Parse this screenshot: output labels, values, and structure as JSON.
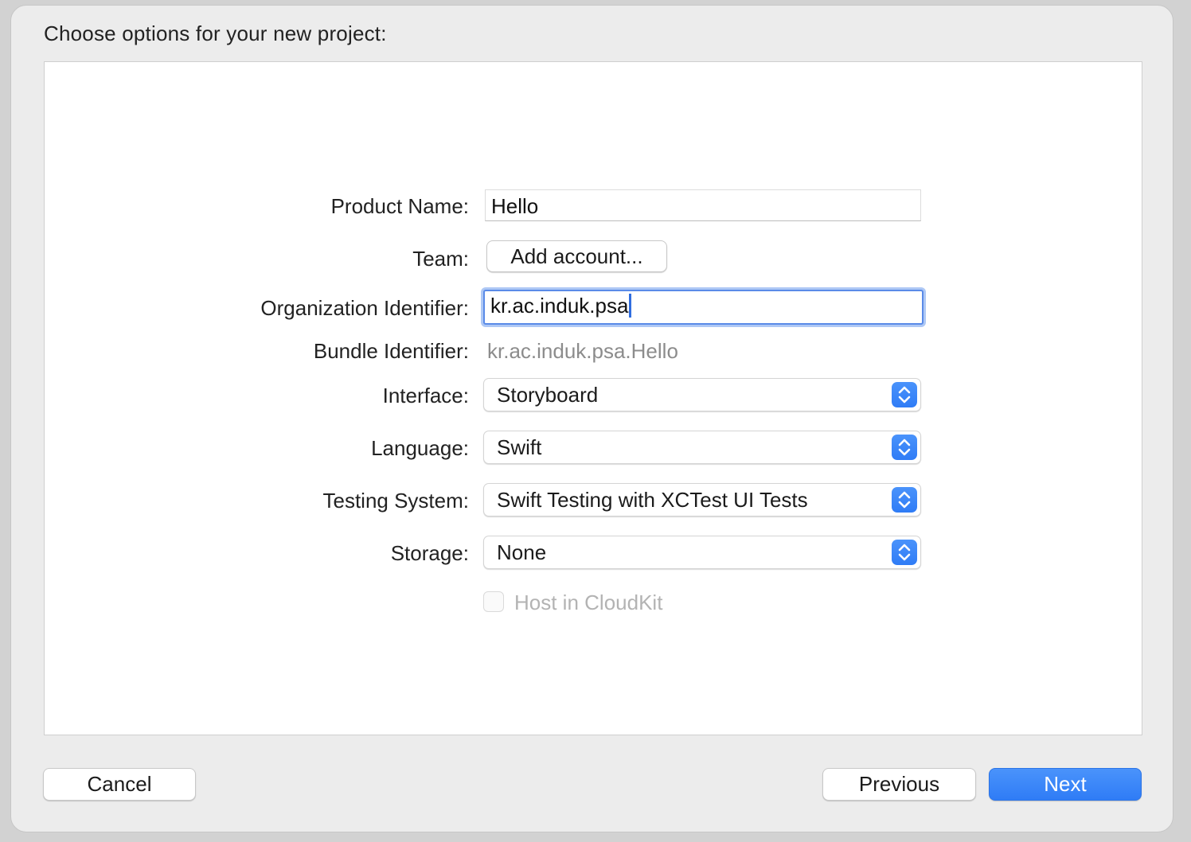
{
  "sheet": {
    "title": "Choose options for your new project:"
  },
  "form": {
    "product_name": {
      "label": "Product Name:",
      "value": "Hello"
    },
    "team": {
      "label": "Team:",
      "button_label": "Add account..."
    },
    "organization_identifier": {
      "label": "Organization Identifier:",
      "value": "kr.ac.induk.psa"
    },
    "bundle_identifier": {
      "label": "Bundle Identifier:",
      "value": "kr.ac.induk.psa.Hello"
    },
    "interface": {
      "label": "Interface:",
      "selected": "Storyboard"
    },
    "language": {
      "label": "Language:",
      "selected": "Swift"
    },
    "testing_system": {
      "label": "Testing System:",
      "selected": "Swift Testing with XCTest UI Tests"
    },
    "storage": {
      "label": "Storage:",
      "selected": "None"
    },
    "host_in_cloudkit": {
      "label": "Host in CloudKit",
      "checked": false,
      "enabled": false
    }
  },
  "footer": {
    "cancel_label": "Cancel",
    "previous_label": "Previous",
    "next_label": "Next"
  },
  "colors": {
    "accent": "#2f7cf6",
    "focus_ring": "#aec8f5",
    "disabled_text": "#b3b3b3",
    "secondary_text": "#8c8c8c"
  },
  "icons": {
    "popup_indicator": "chevron-up-down-icon"
  }
}
